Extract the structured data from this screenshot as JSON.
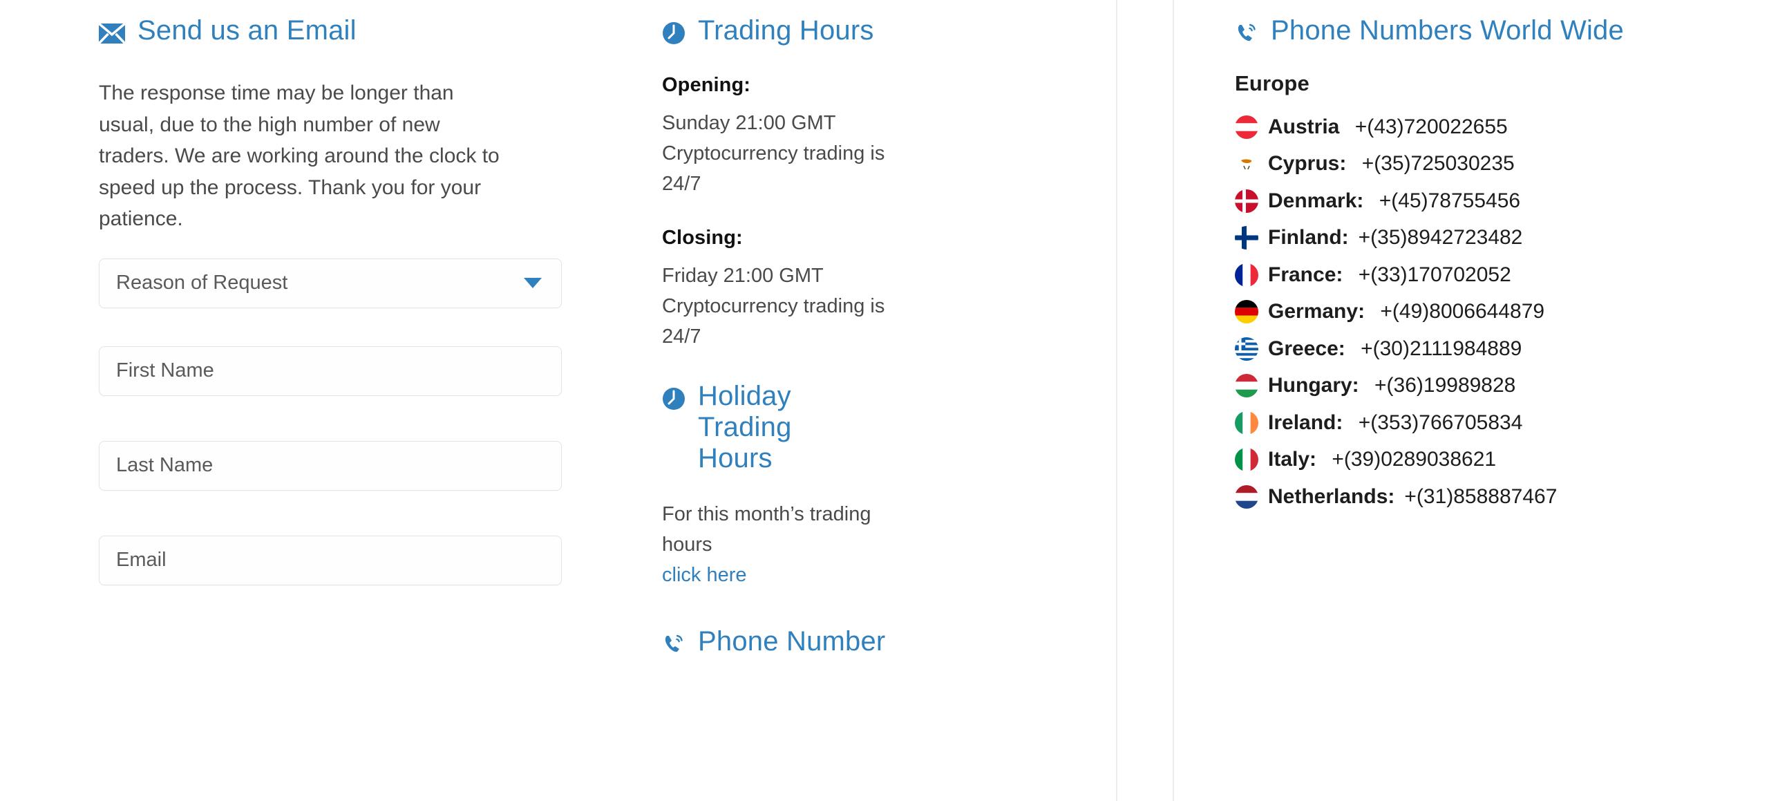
{
  "email_panel": {
    "icon": "envelope-icon",
    "title": "Send us an Email",
    "intro": "The response time may be longer than usual, due to the high number of new traders. We are working around the clock to speed up the process. Thank you for your patience.",
    "fields": {
      "reason_placeholder": "Reason of Request",
      "first_name_placeholder": "First Name",
      "last_name_placeholder": "Last Name",
      "email_placeholder": "Email"
    }
  },
  "trading_hours": {
    "icon": "clock-icon",
    "title": "Trading Hours",
    "opening_label": "Opening:",
    "opening_value": "Sunday 21:00 GMT Cryptocurrency trading is 24/7",
    "closing_label": "Closing:",
    "closing_value": "Friday 21:00 GMT Cryptocurrency trading is 24/7",
    "holiday": {
      "icon": "clock-icon",
      "title": "Holiday Trading Hours",
      "note": "For this month’s trading hours",
      "link_text": "click here"
    },
    "phone_heading": {
      "icon": "phone-icon",
      "title": "Phone Number"
    }
  },
  "phone_numbers": {
    "icon": "phone-icon",
    "title": "Phone Numbers World Wide",
    "region": "Europe",
    "entries": [
      {
        "flag": "flag-austria",
        "country": "Austria ",
        "number": "+(43)720022655"
      },
      {
        "flag": "flag-cyprus",
        "country": "Cyprus: ",
        "number": "+(35)725030235"
      },
      {
        "flag": "flag-denmark",
        "country": "Denmark: ",
        "number": "+(45)78755456"
      },
      {
        "flag": "flag-finland",
        "country": "Finland:",
        "number": "+(35)8942723482"
      },
      {
        "flag": "flag-france",
        "country": "France: ",
        "number": "+(33)170702052"
      },
      {
        "flag": "flag-germany",
        "country": "Germany: ",
        "number": "+(49)8006644879"
      },
      {
        "flag": "flag-greece",
        "country": "Greece: ",
        "number": "+(30)2111984889"
      },
      {
        "flag": "flag-hungary",
        "country": "Hungary: ",
        "number": "+(36)19989828"
      },
      {
        "flag": "flag-ireland",
        "country": "Ireland: ",
        "number": "+(353)766705834"
      },
      {
        "flag": "flag-italy",
        "country": "Italy: ",
        "number": "+(39)0289038621"
      },
      {
        "flag": "flag-netherlands",
        "country": "Netherlands:",
        "number": "+(31)858887467"
      }
    ]
  },
  "colors": {
    "accent_blue": "#2f80bd",
    "body_text": "#4a4a4a",
    "heading_dark": "#1d1d1d",
    "border": "#e3e3e3",
    "divider": "#ececec"
  }
}
